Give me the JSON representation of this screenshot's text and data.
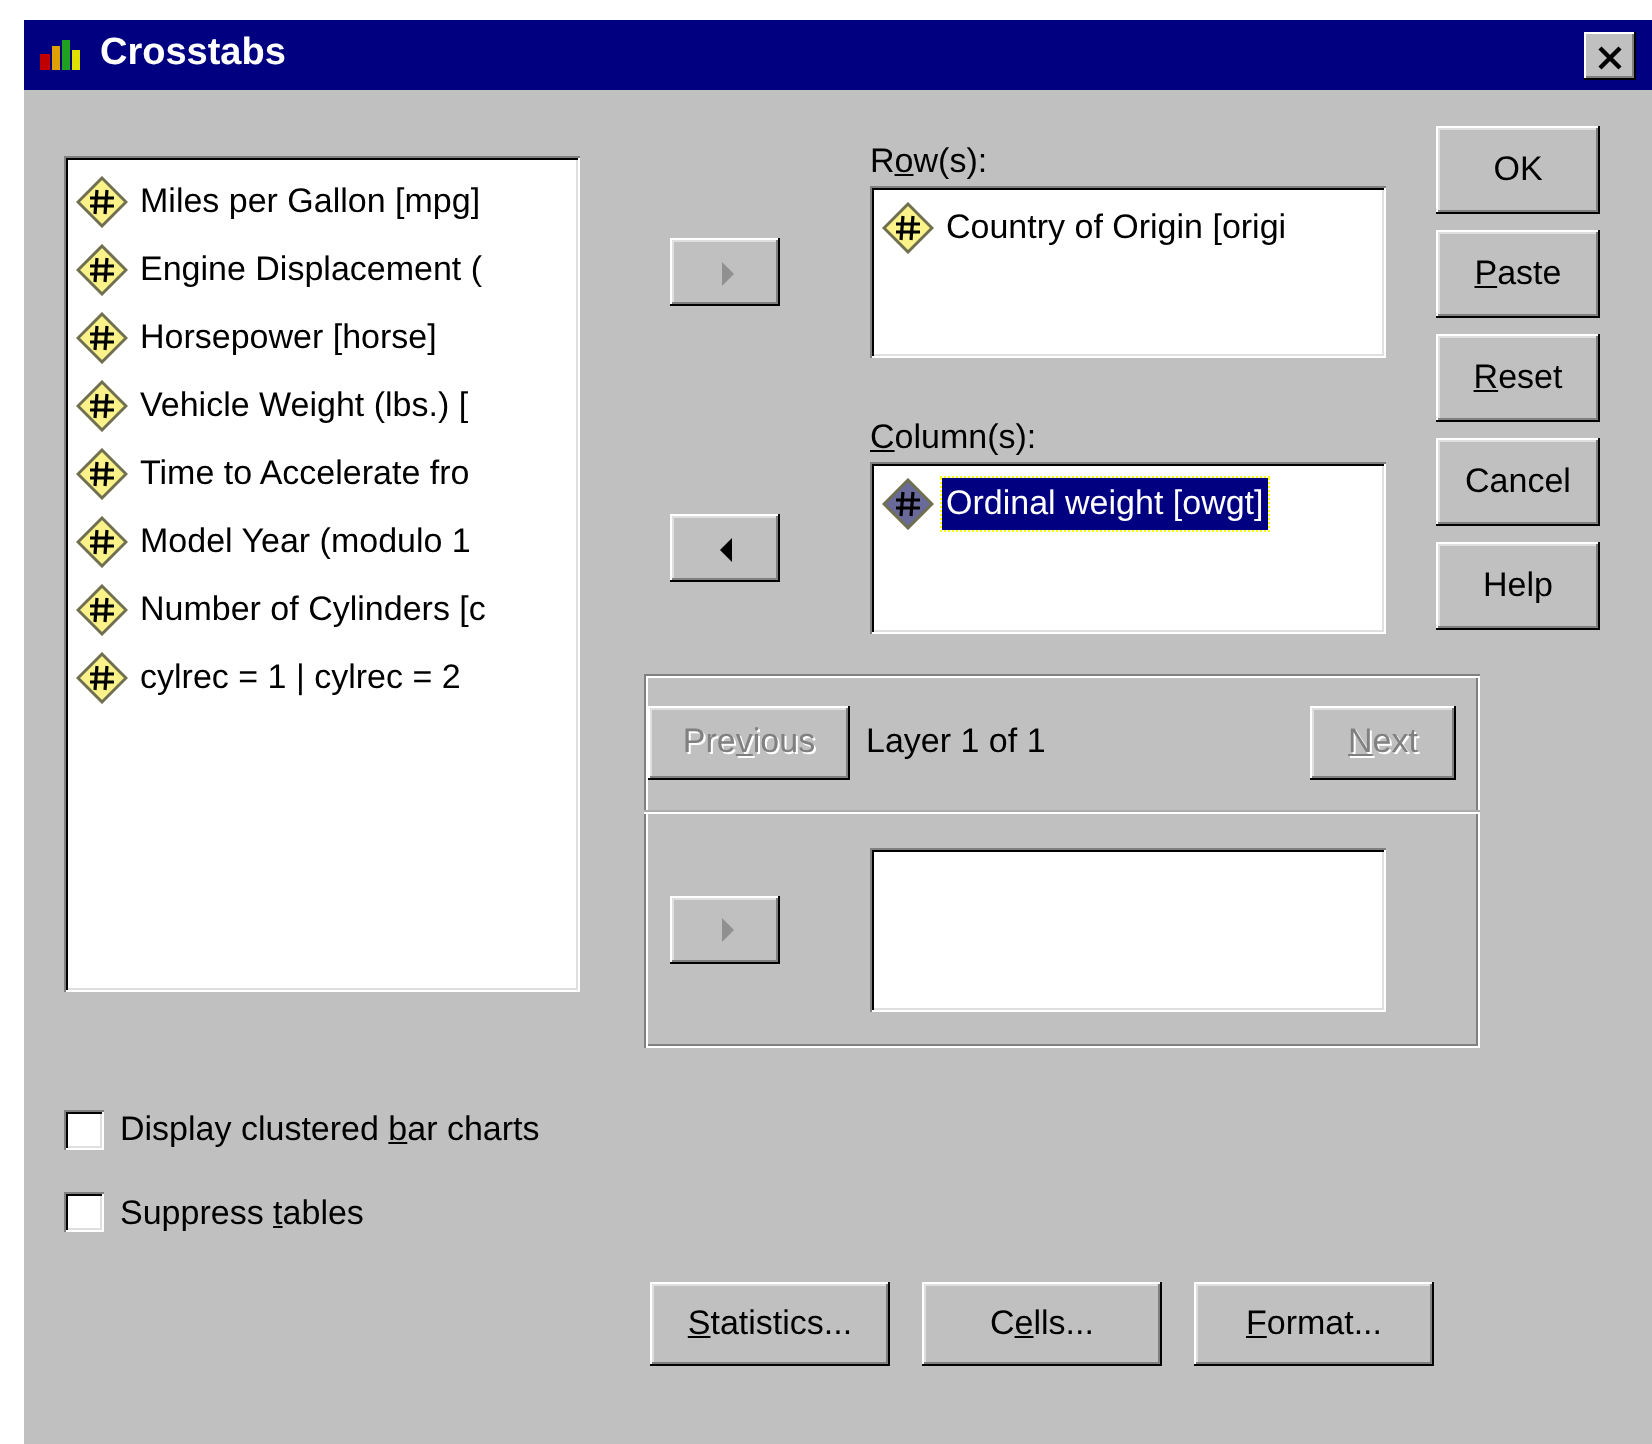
{
  "window": {
    "title": "Crosstabs"
  },
  "variables": [
    {
      "label": "Miles per Gallon [mpg]",
      "selected": false
    },
    {
      "label": "Engine Displacement (",
      "selected": false
    },
    {
      "label": "Horsepower [horse]",
      "selected": false
    },
    {
      "label": "Vehicle Weight (lbs.) [",
      "selected": false
    },
    {
      "label": "Time to Accelerate fro",
      "selected": false
    },
    {
      "label": "Model Year (modulo 1",
      "selected": false
    },
    {
      "label": "Number of Cylinders [c",
      "selected": false
    },
    {
      "label": "cylrec = 1 | cylrec = 2",
      "selected": false
    }
  ],
  "move_buttons": [
    {
      "kind": "right",
      "disabled": true
    },
    {
      "kind": "left",
      "disabled": false
    }
  ],
  "rows_box": {
    "label": {
      "before": "R",
      "accel": "o",
      "after": "w(s):"
    },
    "items": [
      {
        "label": "Country of Origin [origi",
        "selected": false
      }
    ]
  },
  "columns_box": {
    "label": {
      "accel": "C",
      "after": "olumn(s):"
    },
    "items": [
      {
        "label": "Ordinal weight [owgt]",
        "selected": true
      }
    ]
  },
  "actions": [
    {
      "after": "OK"
    },
    {
      "accel": "P",
      "after": "aste"
    },
    {
      "accel": "R",
      "after": "eset"
    },
    {
      "after": "Cancel"
    },
    {
      "after": "Help"
    }
  ],
  "layer": {
    "previous": {
      "before": "Pre",
      "accel": "v",
      "after": "ious",
      "disabled": true
    },
    "text": "Layer 1 of 1",
    "next": {
      "accel": "N",
      "after": "ext",
      "disabled": true
    },
    "move_button": {
      "kind": "right",
      "disabled": true
    }
  },
  "options": [
    {
      "label": {
        "before": "Display clustered ",
        "accel": "b",
        "after": "ar charts"
      },
      "checked": false
    },
    {
      "label": {
        "before": "Suppress ",
        "accel": "t",
        "after": "ables"
      },
      "checked": false
    }
  ],
  "bottom_buttons": [
    {
      "accel": "S",
      "after": "tatistics..."
    },
    {
      "before": "C",
      "accel": "e",
      "after": "lls..."
    },
    {
      "accel": "F",
      "after": "ormat..."
    }
  ]
}
